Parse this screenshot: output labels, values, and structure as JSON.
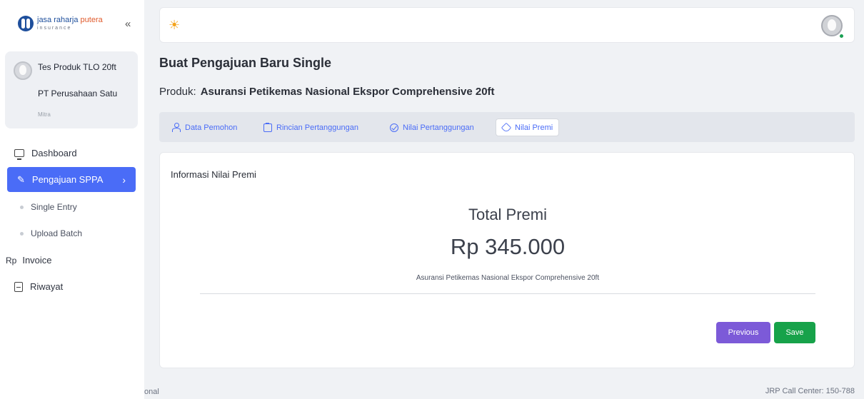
{
  "brand": {
    "name_main": "jasa raharja ",
    "name_accent": "putera",
    "sub": "insurance",
    "collapse_glyph": "«"
  },
  "user": {
    "name": "Tes Produk TLO 20ft",
    "company": "PT Perusahaan Satu",
    "role": "Mitra"
  },
  "nav": {
    "dashboard": "Dashboard",
    "pengajuan": "Pengajuan SPPA",
    "pengajuan_chevron": "›",
    "single_entry": "Single Entry",
    "upload_batch": "Upload Batch",
    "invoice_icon": "Rp",
    "invoice": "Invoice",
    "riwayat": "Riwayat"
  },
  "header": {
    "theme_icon": "sun-icon",
    "sun_glyph": "☀"
  },
  "page": {
    "title": "Buat Pengajuan Baru Single",
    "product_label": "Produk:",
    "product_name": "Asuransi Petikemas Nasional Ekspor Comprehensive 20ft"
  },
  "tabs": [
    {
      "label": "Data Pemohon",
      "icon": "user-icon"
    },
    {
      "label": "Rincian Pertanggungan",
      "icon": "clipboard-icon"
    },
    {
      "label": "Nilai Pertanggungan",
      "icon": "check-circle-icon"
    },
    {
      "label": "Nilai Premi",
      "icon": "tag-icon",
      "active": true
    }
  ],
  "card": {
    "title": "Informasi Nilai Premi",
    "total_label": "Total Premi",
    "total_value": "Rp 345.000",
    "product_caption": "Asuransi Petikemas Nasional Ekspor Comprehensive 20ft"
  },
  "actions": {
    "previous": "Previous",
    "save": "Save"
  },
  "footer": {
    "left": "onal",
    "right": "JRP Call Center: 150-788"
  },
  "colors": {
    "accent": "#4a6cf7",
    "previous_button": "#7c5ad8",
    "save_button": "#17a24a",
    "brand_blue": "#1e4f9c",
    "brand_orange": "#e05a2b"
  }
}
